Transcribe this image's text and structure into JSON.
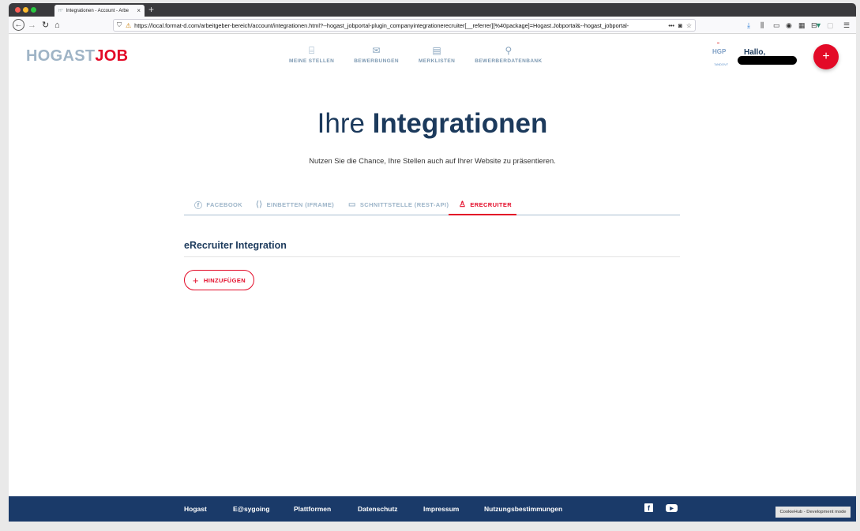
{
  "browser": {
    "tab_title": "Integrationen - Account - Arbe",
    "tab_favicon": "H°",
    "url": "https://local.format-d.com/arbeitgeber-bereich/account/integrationen.html?--hogast_jobportal-plugin_companyintegrationerecruiter[__referrer][%40package]=Hogast.Jobportal&--hogast_jobportal-",
    "page_actions": "•••"
  },
  "header": {
    "logo_part1": "HOGAST",
    "logo_part2": "JOB",
    "nav": [
      {
        "label": "MEINE STELLEN",
        "icon": "briefcase-icon"
      },
      {
        "label": "BEWERBUNGEN",
        "icon": "mail-icon"
      },
      {
        "label": "MERKLISTEN",
        "icon": "bookmark-list-icon"
      },
      {
        "label": "BEWERBERDATENBANK",
        "icon": "search-icon"
      }
    ],
    "company_logo_text": "HGP",
    "company_logo_sub": "\"ANDOVI\"",
    "greeting": "Hallo,",
    "fab_label": "+"
  },
  "hero": {
    "title_light": "Ihre ",
    "title_bold": "Integrationen",
    "subtitle": "Nutzen Sie die Chance, Ihre Stellen auch auf Ihrer Website zu präsentieren."
  },
  "tabs": [
    {
      "label": "FACEBOOK",
      "icon": "facebook-icon"
    },
    {
      "label": "EINBETTEN (IFRAME)",
      "icon": "code-icon"
    },
    {
      "label": "SCHNITTSTELLE (REST-API)",
      "icon": "window-icon"
    },
    {
      "label": "ERECRUITER",
      "icon": "person-icon",
      "active": true
    }
  ],
  "section": {
    "title": "eRecruiter Integration",
    "add_label": "HINZUFÜGEN"
  },
  "footer": {
    "links": [
      "Hogast",
      "E@sygoing",
      "Plattformen",
      "Datenschutz",
      "Impressum",
      "Nutzungsbestimmungen"
    ],
    "cookie_label": "CookieHub - Development mode"
  },
  "colors": {
    "brand_red": "#e30a27",
    "brand_navy": "#1c3a5c",
    "footer_bg": "#1a3a69"
  }
}
